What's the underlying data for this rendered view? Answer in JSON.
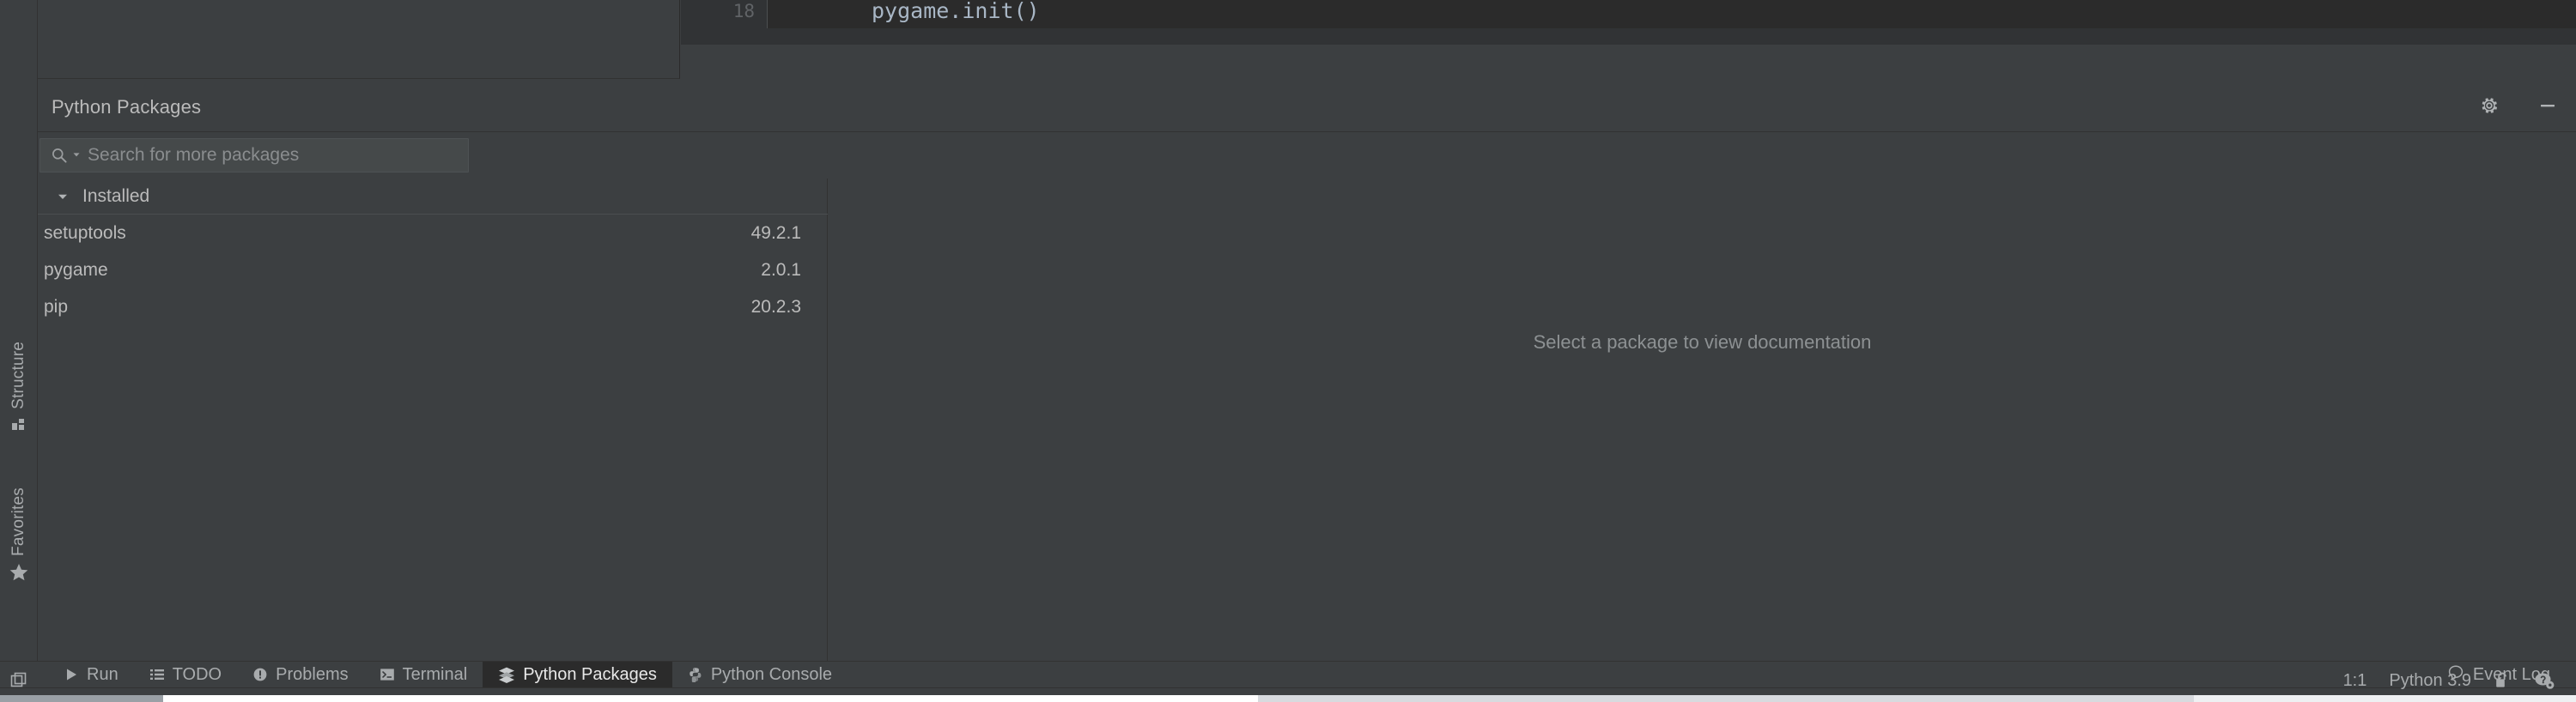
{
  "editor": {
    "line_number": "18",
    "code": "pygame.init()"
  },
  "left_sidebar": {
    "items": [
      {
        "label": "Structure",
        "icon": "structure-grid-icon"
      },
      {
        "label": "Favorites",
        "icon": "star-icon"
      }
    ]
  },
  "tool_window": {
    "title": "Python Packages",
    "actions": [
      {
        "name": "settings",
        "icon": "gear-icon"
      },
      {
        "name": "minimize",
        "icon": "minimize-icon"
      }
    ],
    "search": {
      "placeholder": "Search for more packages",
      "value": "",
      "icon": "search-icon"
    },
    "group": {
      "label": "Installed",
      "expanded": true
    },
    "packages": [
      {
        "name": "setuptools",
        "version": "49.2.1"
      },
      {
        "name": "pygame",
        "version": "2.0.1"
      },
      {
        "name": "pip",
        "version": "20.2.3"
      }
    ],
    "documentation_placeholder": "Select a package to view documentation"
  },
  "bottom_tabs": [
    {
      "label": "Run",
      "icon": "play-icon",
      "active": false
    },
    {
      "label": "TODO",
      "icon": "list-icon",
      "active": false
    },
    {
      "label": "Problems",
      "icon": "warning-icon",
      "active": false
    },
    {
      "label": "Terminal",
      "icon": "terminal-icon",
      "active": false
    },
    {
      "label": "Python Packages",
      "icon": "layers-icon",
      "active": true
    },
    {
      "label": "Python Console",
      "icon": "python-icon",
      "active": false
    }
  ],
  "event_log": {
    "label": "Event Log",
    "icon": "balloon-icon"
  },
  "status_bar": {
    "layout_icon": "layout-icon",
    "caret_position": "1:1",
    "interpreter": "Python 3.9",
    "lock_icon": "unlocked-padlock-icon",
    "help_icon": "help-gear-icon"
  },
  "colors": {
    "window_bg": "#3c3f41",
    "editor_bg": "#2b2b2b",
    "text": "#bbbbbb",
    "muted_text": "#8d9193",
    "active_tab_bg": "#2b2b2b",
    "code_text": "#a9b7c6"
  }
}
